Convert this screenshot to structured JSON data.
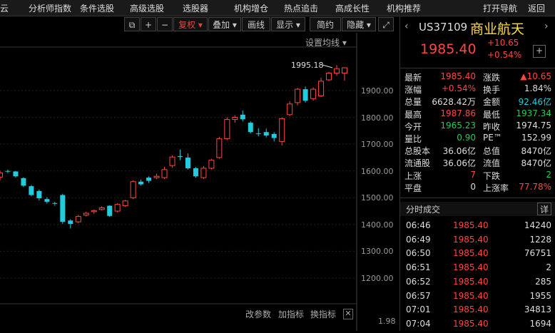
{
  "menu": [
    "云",
    "分析师指数",
    "条件选股",
    "高级选股",
    "选股器",
    "机构增仓",
    "热点追击",
    "高成长性",
    "机构推荐",
    "打开导航",
    "返回"
  ],
  "toolbar": {
    "fuquan": "复权",
    "diejia": "叠加",
    "huaxian": "画线",
    "xianshi": "显示",
    "jianyue": "简约",
    "yincang": "隐藏"
  },
  "chart": {
    "setting_label": "设置均线",
    "high_label": "1995.18",
    "y_ticks": [
      "1900.00",
      "1800.00",
      "1700.00",
      "1600.00",
      "1500.00",
      "1400.00",
      "1300.00",
      "1200.00",
      "1.98"
    ],
    "bottom": {
      "gai": "改参数",
      "add": "加指标",
      "switch": "换指标"
    }
  },
  "chart_data": {
    "type": "candlestick",
    "ylim": [
      1200,
      1900
    ],
    "candles": [
      [
        1577,
        1593,
        1565,
        1600,
        "up"
      ],
      [
        1600,
        1598,
        1592,
        1605,
        "dn"
      ],
      [
        1598,
        1580,
        1575,
        1600,
        "dn"
      ],
      [
        1573,
        1545,
        1540,
        1576,
        "dn"
      ],
      [
        1543,
        1510,
        1505,
        1548,
        "dn"
      ],
      [
        1525,
        1498,
        1490,
        1530,
        "dn"
      ],
      [
        1495,
        1485,
        1478,
        1502,
        "dn"
      ],
      [
        1480,
        1478,
        1470,
        1485,
        "dn"
      ],
      [
        1510,
        1410,
        1402,
        1515,
        "dn"
      ],
      [
        1415,
        1402,
        1385,
        1420,
        "dn"
      ],
      [
        1410,
        1430,
        1405,
        1436,
        "up"
      ],
      [
        1435,
        1442,
        1430,
        1448,
        "up"
      ],
      [
        1448,
        1452,
        1440,
        1456,
        "up"
      ],
      [
        1456,
        1462,
        1452,
        1468,
        "up"
      ],
      [
        1470,
        1432,
        1428,
        1472,
        "dn"
      ],
      [
        1450,
        1475,
        1445,
        1480,
        "up"
      ],
      [
        1470,
        1488,
        1465,
        1492,
        "up"
      ],
      [
        1500,
        1560,
        1495,
        1565,
        "up"
      ],
      [
        1560,
        1550,
        1545,
        1568,
        "dn"
      ],
      [
        1575,
        1563,
        1555,
        1580,
        "dn"
      ],
      [
        1575,
        1580,
        1570,
        1590,
        "up"
      ],
      [
        1575,
        1605,
        1570,
        1615,
        "up"
      ],
      [
        1620,
        1652,
        1612,
        1658,
        "up"
      ],
      [
        1655,
        1652,
        1640,
        1680,
        "dn"
      ],
      [
        1650,
        1610,
        1605,
        1665,
        "dn"
      ],
      [
        1610,
        1580,
        1575,
        1615,
        "dn"
      ],
      [
        1575,
        1610,
        1570,
        1618,
        "up"
      ],
      [
        1610,
        1640,
        1605,
        1645,
        "up"
      ],
      [
        1650,
        1720,
        1645,
        1728,
        "up"
      ],
      [
        1720,
        1792,
        1715,
        1800,
        "up"
      ],
      [
        1792,
        1800,
        1780,
        1808,
        "up"
      ],
      [
        1810,
        1793,
        1785,
        1825,
        "dn"
      ],
      [
        1780,
        1745,
        1740,
        1785,
        "dn"
      ],
      [
        1740,
        1738,
        1730,
        1760,
        "dn"
      ],
      [
        1745,
        1732,
        1725,
        1758,
        "dn"
      ],
      [
        1738,
        1723,
        1710,
        1745,
        "dn"
      ],
      [
        1710,
        1795,
        1695,
        1800,
        "up"
      ],
      [
        1810,
        1850,
        1805,
        1860,
        "up"
      ],
      [
        1855,
        1905,
        1845,
        1910,
        "up"
      ],
      [
        1905,
        1862,
        1855,
        1915,
        "dn"
      ],
      [
        1870,
        1905,
        1862,
        1912,
        "up"
      ],
      [
        1880,
        1935,
        1875,
        1948,
        "up"
      ],
      [
        1940,
        1965,
        1935,
        1970,
        "up"
      ],
      [
        1965,
        1982,
        1955,
        1995,
        "up"
      ],
      [
        1965,
        1985,
        1937,
        1987,
        "up"
      ]
    ]
  },
  "stock": {
    "code": "US37109",
    "name": "商业航天",
    "price": "1985.40",
    "change": "+10.65",
    "pct": "+0.54%"
  },
  "quotes": [
    [
      "最新",
      "1985.40",
      "涨跌",
      "▲10.65"
    ],
    [
      "涨幅",
      "+0.54%",
      "换手",
      "1.84%"
    ],
    [
      "总量",
      "6628.42万",
      "金额",
      "92.46亿"
    ],
    [
      "最高",
      "1987.86",
      "最低",
      "1937.34"
    ],
    [
      "今开",
      "1965.23",
      "昨收",
      "1974.75"
    ],
    [
      "量比",
      "0.90",
      "PE™",
      "152.99"
    ],
    [
      "总股本",
      "36.06亿",
      "总值",
      "8470亿"
    ],
    [
      "流通股",
      "36.06亿",
      "流值",
      "8470亿"
    ],
    [
      "上涨",
      "7",
      "下跌",
      "2"
    ],
    [
      "平盘",
      "0",
      "上涨率",
      "77.78%"
    ]
  ],
  "trades_title": "分时成交",
  "trades_btn": "详",
  "trades": [
    [
      "06:46",
      "1985.40",
      "14240"
    ],
    [
      "06:49",
      "1985.40",
      "1228"
    ],
    [
      "06:50",
      "1985.40",
      "76751"
    ],
    [
      "06:51",
      "1985.40",
      "2"
    ],
    [
      "06:52",
      "1985.40",
      "285"
    ],
    [
      "06:57",
      "1985.40",
      "1955"
    ],
    [
      "07:01",
      "1985.40",
      "34813"
    ],
    [
      "07:04",
      "1985.40",
      "1694"
    ]
  ],
  "colors": {
    "up": "#ff4545",
    "down": "#22ccdd",
    "bg": "#000000"
  }
}
